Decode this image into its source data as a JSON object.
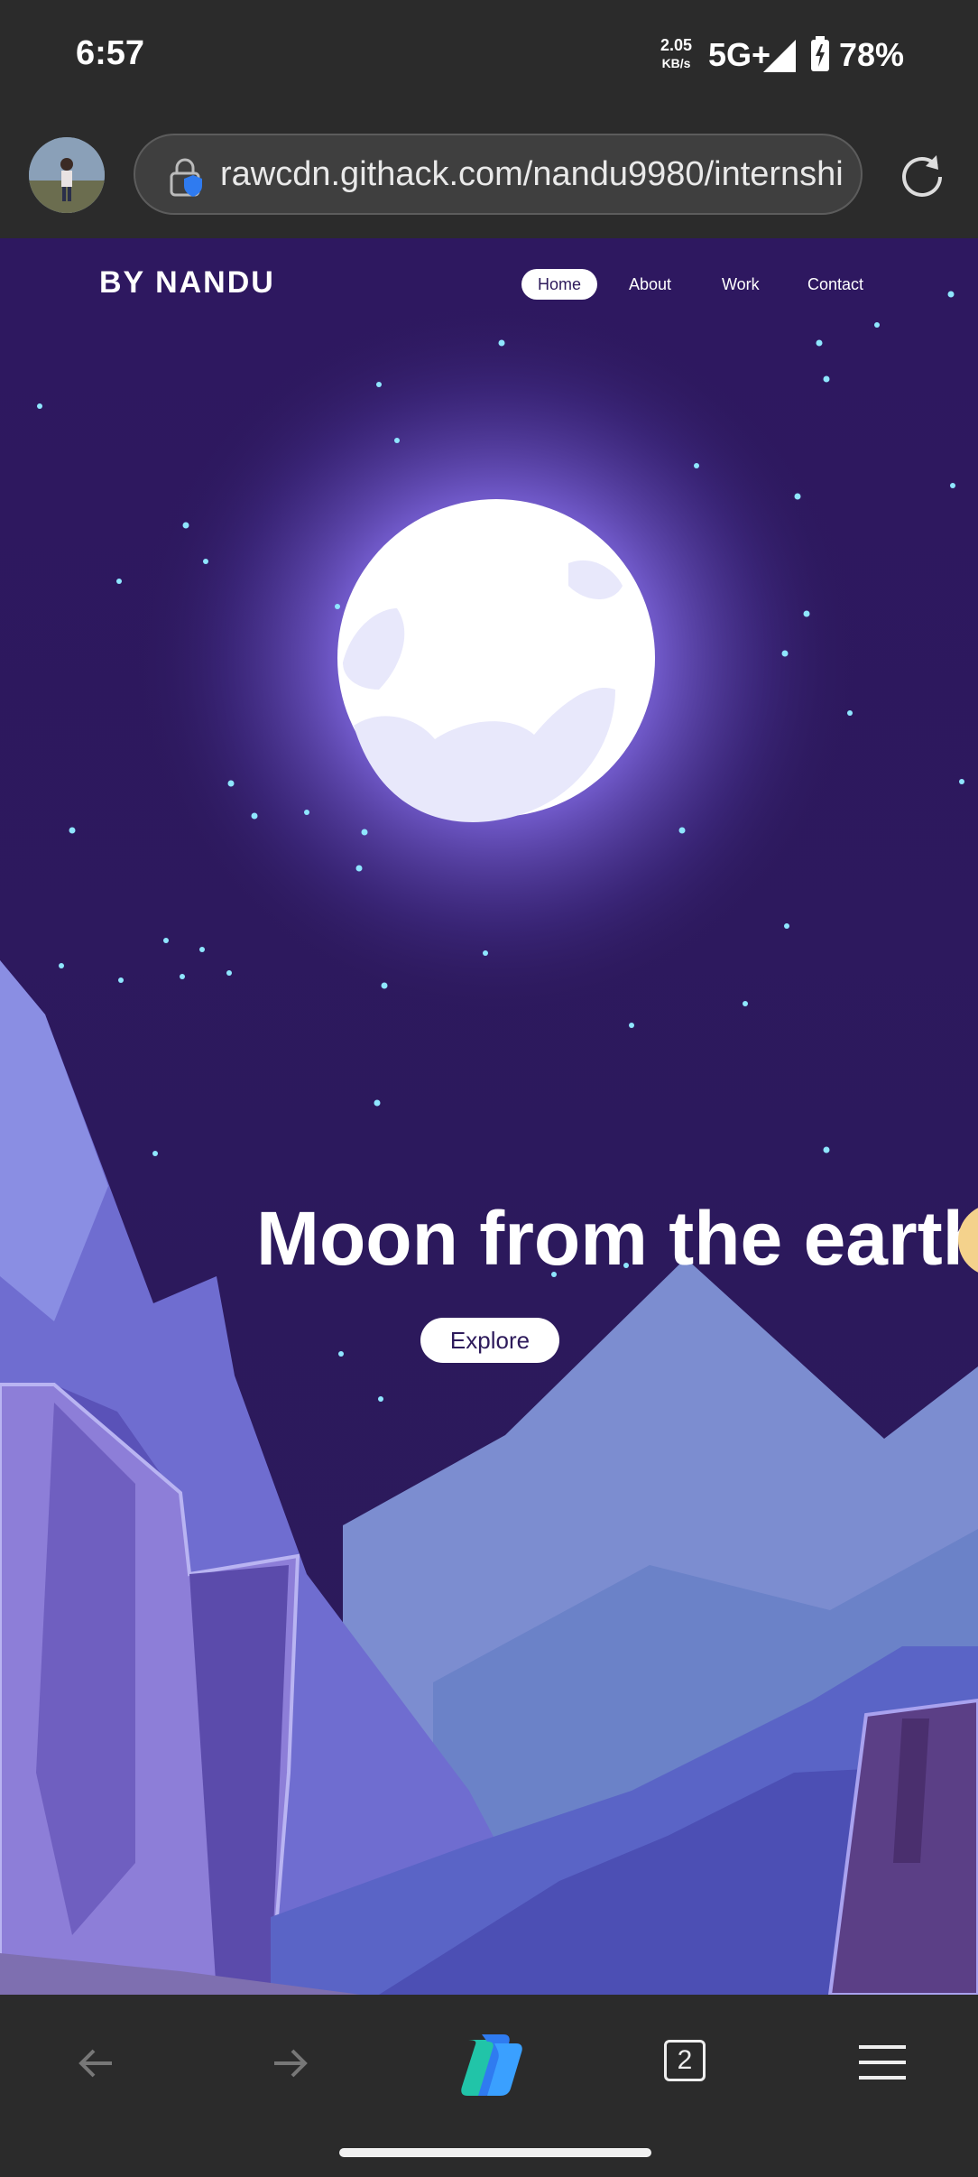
{
  "status": {
    "time": "6:57",
    "speed_value": "2.05",
    "speed_unit": "KB/s",
    "network": "5G+",
    "battery": "78%"
  },
  "browser": {
    "url": "rawcdn.githack.com/nandu9980/internshi",
    "tab_count": "2"
  },
  "site": {
    "brand": "BY NANDU",
    "nav": [
      "Home",
      "About",
      "Work",
      "Contact"
    ],
    "active_nav": "Home",
    "hero_title": "Moon from the earth",
    "cta": "Explore"
  },
  "colors": {
    "sky": "#2d1a5b",
    "moon": "#ffffff",
    "mountain": "#6b6fd1",
    "star": "#8fe6ff"
  }
}
